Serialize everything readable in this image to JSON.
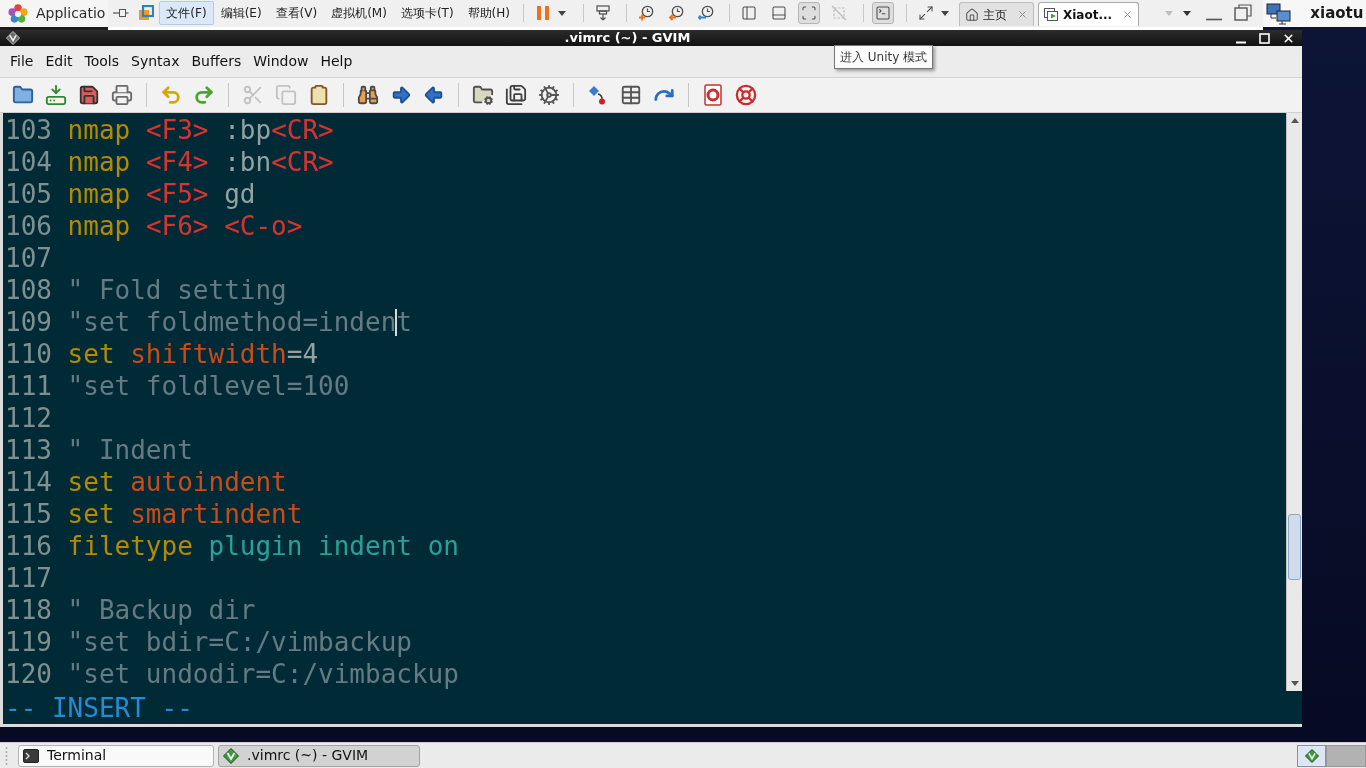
{
  "top_panel": {
    "applications_label": "Applicatio",
    "user_name": "xiaotu"
  },
  "vmware_toolbar": {
    "menus": [
      {
        "label": "文件(F)",
        "selected": true
      },
      {
        "label": "编辑(E)",
        "selected": false
      },
      {
        "label": "查看(V)",
        "selected": false
      },
      {
        "label": "虚拟机(M)",
        "selected": false
      },
      {
        "label": "选项卡(T)",
        "selected": false
      },
      {
        "label": "帮助(H)",
        "selected": false
      }
    ],
    "tool_buttons": [
      {
        "selected": false,
        "disabled": false
      },
      {
        "selected": false,
        "disabled": false
      },
      {
        "selected": false,
        "disabled": false
      },
      {
        "selected": false,
        "disabled": false
      },
      {
        "selected": false,
        "disabled": false
      },
      {
        "selected": false,
        "disabled": false
      },
      {
        "selected": false,
        "disabled": false
      },
      {
        "selected": true,
        "disabled": false
      },
      {
        "selected": false,
        "disabled": true
      },
      {
        "selected": true,
        "disabled": false
      },
      {
        "selected": false,
        "disabled": false
      }
    ],
    "tabs": [
      {
        "label": "主页",
        "selected": false
      },
      {
        "label": "Xiaot...",
        "selected": true
      }
    ],
    "tooltip": "进入 Unity 模式"
  },
  "window": {
    "title": ".vimrc (~) - GVIM"
  },
  "menu_bar": [
    "File",
    "Edit",
    "Tools",
    "Syntax",
    "Buffers",
    "Window",
    "Help"
  ],
  "toolbar": {
    "buttons": [
      {
        "disabled": false
      },
      {
        "disabled": false
      },
      {
        "disabled": false
      },
      {
        "disabled": false
      },
      {
        "disabled": false
      },
      {
        "disabled": false
      },
      {
        "disabled": true
      },
      {
        "disabled": true
      },
      {
        "disabled": false
      },
      {
        "disabled": false
      },
      {
        "disabled": false
      },
      {
        "disabled": false
      },
      {
        "disabled": false
      },
      {
        "disabled": false
      },
      {
        "disabled": false
      },
      {
        "disabled": false
      },
      {
        "disabled": false
      },
      {
        "disabled": false
      },
      {
        "disabled": false
      },
      {
        "disabled": false
      }
    ]
  },
  "editor": {
    "lines": [
      {
        "number": "103",
        "tokens": [
          {
            "text": "nmap",
            "kind": "statement",
            "cursor": false
          },
          {
            "text": " <F3>",
            "kind": "special",
            "cursor": false
          },
          {
            "text": " :bp",
            "kind": "text",
            "cursor": false
          },
          {
            "text": "<CR>",
            "kind": "special",
            "cursor": false
          }
        ]
      },
      {
        "number": "104",
        "tokens": [
          {
            "text": "nmap",
            "kind": "statement",
            "cursor": false
          },
          {
            "text": " <F4>",
            "kind": "special",
            "cursor": false
          },
          {
            "text": " :bn",
            "kind": "text",
            "cursor": false
          },
          {
            "text": "<CR>",
            "kind": "special",
            "cursor": false
          }
        ]
      },
      {
        "number": "105",
        "tokens": [
          {
            "text": "nmap",
            "kind": "statement",
            "cursor": false
          },
          {
            "text": " <F5>",
            "kind": "special",
            "cursor": false
          },
          {
            "text": " gd",
            "kind": "text",
            "cursor": false
          }
        ]
      },
      {
        "number": "106",
        "tokens": [
          {
            "text": "nmap",
            "kind": "statement",
            "cursor": false
          },
          {
            "text": " <F6>",
            "kind": "special",
            "cursor": false
          },
          {
            "text": " <C-o>",
            "kind": "special",
            "cursor": false
          }
        ]
      },
      {
        "number": "107"
      },
      {
        "number": "108",
        "tokens": [
          {
            "text": "\" Fold setting",
            "kind": "comment",
            "cursor": false
          }
        ]
      },
      {
        "number": "109",
        "tokens": [
          {
            "text": "\"set foldmethod=inden",
            "kind": "comment",
            "cursor": false
          },
          {
            "text": "t",
            "kind": "comment",
            "cursor": true
          }
        ]
      },
      {
        "number": "110",
        "tokens": [
          {
            "text": "set",
            "kind": "statement",
            "cursor": false
          },
          {
            "text": " shiftwidth",
            "kind": "option",
            "cursor": false
          },
          {
            "text": "=4",
            "kind": "text",
            "cursor": false
          }
        ]
      },
      {
        "number": "111",
        "tokens": [
          {
            "text": "\"set foldlevel=100",
            "kind": "comment",
            "cursor": false
          }
        ]
      },
      {
        "number": "112"
      },
      {
        "number": "113",
        "tokens": [
          {
            "text": "\" Indent",
            "kind": "comment",
            "cursor": false
          }
        ]
      },
      {
        "number": "114",
        "tokens": [
          {
            "text": "set",
            "kind": "statement",
            "cursor": false
          },
          {
            "text": " autoindent",
            "kind": "option",
            "cursor": false
          }
        ]
      },
      {
        "number": "115",
        "tokens": [
          {
            "text": "set",
            "kind": "statement",
            "cursor": false
          },
          {
            "text": " smartindent",
            "kind": "option",
            "cursor": false
          }
        ]
      },
      {
        "number": "116",
        "tokens": [
          {
            "text": "filetype",
            "kind": "statement",
            "cursor": false
          },
          {
            "text": " plugin indent on",
            "kind": "constant",
            "cursor": false
          }
        ]
      },
      {
        "number": "117"
      },
      {
        "number": "118",
        "tokens": [
          {
            "text": "\" Backup dir",
            "kind": "comment",
            "cursor": false
          }
        ]
      },
      {
        "number": "119",
        "tokens": [
          {
            "text": "\"set bdir=C:/vimbackup",
            "kind": "comment",
            "cursor": false
          }
        ]
      },
      {
        "number": "120",
        "tokens": [
          {
            "text": "\"set undodir=C:/vimbackup",
            "kind": "comment",
            "cursor": false
          }
        ]
      }
    ],
    "mode": "-- INSERT --"
  },
  "taskbar": {
    "items": [
      {
        "label": "Terminal",
        "selected": false
      },
      {
        "label": ".vimrc (~) - GVIM",
        "selected": true
      }
    ],
    "workspaces": [
      {
        "selected": true
      },
      {
        "selected": false
      }
    ]
  }
}
